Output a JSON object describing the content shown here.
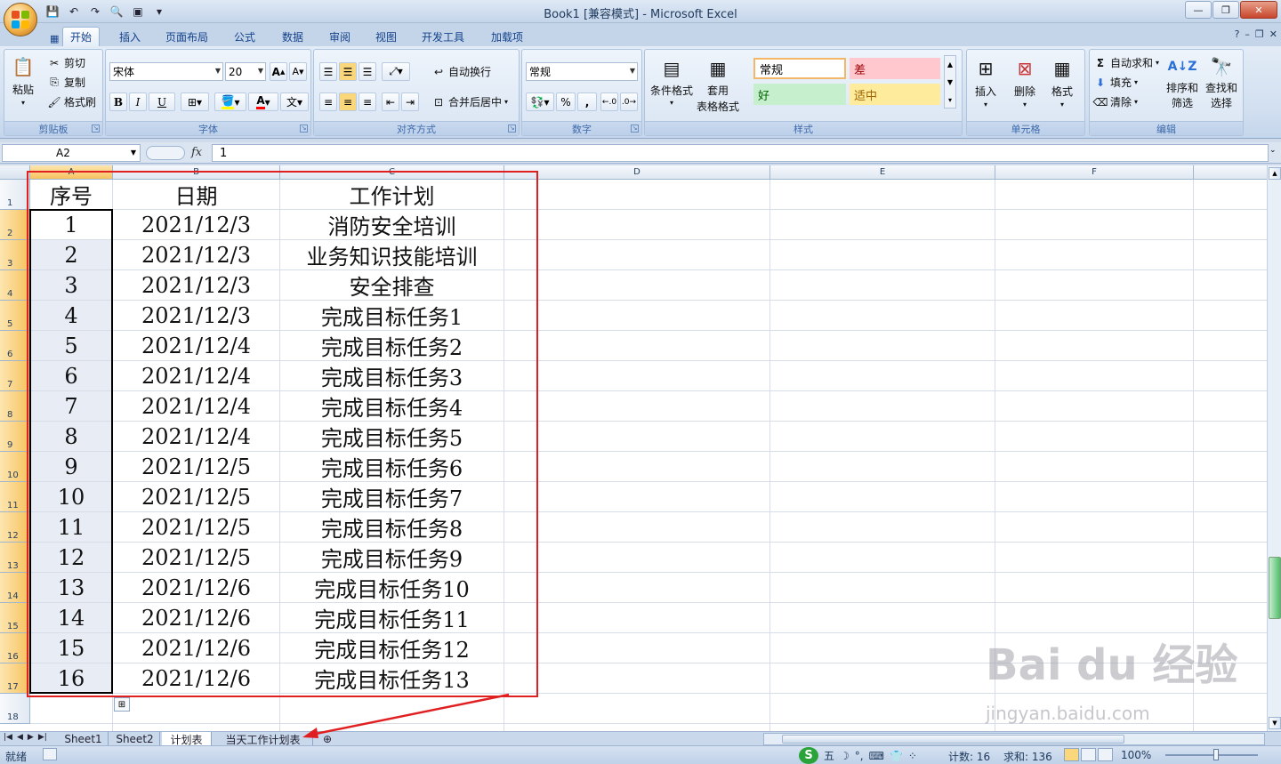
{
  "window": {
    "title": "Book1  [兼容模式] - Microsoft Excel"
  },
  "ribbon_tabs": [
    "开始",
    "插入",
    "页面布局",
    "公式",
    "数据",
    "审阅",
    "视图",
    "开发工具",
    "加载项"
  ],
  "clipboard": {
    "paste": "粘贴",
    "cut": "剪切",
    "copy": "复制",
    "format_painter": "格式刷",
    "label": "剪贴板"
  },
  "font": {
    "name": "宋体",
    "size": "20",
    "bold": "B",
    "italic": "I",
    "underline": "U",
    "label": "字体"
  },
  "alignment": {
    "wrap_text": "自动换行",
    "merge_center": "合并后居中",
    "label": "对齐方式"
  },
  "number": {
    "format": "常规",
    "percent": "%",
    "comma": ",",
    "label": "数字"
  },
  "styles": {
    "conditional": "条件格式",
    "table_line1": "套用",
    "table_line2": "表格格式",
    "normal": "常规",
    "bad": "差",
    "good": "好",
    "neutral": "适中",
    "label": "样式",
    "colors": {
      "bad_bg": "#ffc7ce",
      "bad_fg": "#9c0006",
      "good_bg": "#c6efce",
      "good_fg": "#006100",
      "neutral_bg": "#ffeb9c",
      "neutral_fg": "#9c6500"
    }
  },
  "cells_group": {
    "insert": "插入",
    "delete": "删除",
    "format": "格式",
    "label": "单元格"
  },
  "editing": {
    "autosum": "自动求和",
    "fill": "填充",
    "clear": "清除",
    "sort_line1": "排序和",
    "sort_line2": "筛选",
    "find_line1": "查找和",
    "find_line2": "选择",
    "label": "编辑"
  },
  "formula_bar": {
    "name_box": "A2",
    "fx": "fx",
    "value": "1"
  },
  "columns": [
    "A",
    "B",
    "C",
    "D",
    "E",
    "F"
  ],
  "row_numbers": [
    "1",
    "2",
    "3",
    "4",
    "5",
    "6",
    "7",
    "8",
    "9",
    "10",
    "11",
    "12",
    "13",
    "14",
    "15",
    "16",
    "17",
    "18"
  ],
  "table": {
    "headers": [
      "序号",
      "日期",
      "工作计划"
    ],
    "rows": [
      [
        "1",
        "2021/12/3",
        "消防安全培训"
      ],
      [
        "2",
        "2021/12/3",
        "业务知识技能培训"
      ],
      [
        "3",
        "2021/12/3",
        "安全排查"
      ],
      [
        "4",
        "2021/12/3",
        "完成目标任务1"
      ],
      [
        "5",
        "2021/12/4",
        "完成目标任务2"
      ],
      [
        "6",
        "2021/12/4",
        "完成目标任务3"
      ],
      [
        "7",
        "2021/12/4",
        "完成目标任务4"
      ],
      [
        "8",
        "2021/12/4",
        "完成目标任务5"
      ],
      [
        "9",
        "2021/12/5",
        "完成目标任务6"
      ],
      [
        "10",
        "2021/12/5",
        "完成目标任务7"
      ],
      [
        "11",
        "2021/12/5",
        "完成目标任务8"
      ],
      [
        "12",
        "2021/12/5",
        "完成目标任务9"
      ],
      [
        "13",
        "2021/12/6",
        "完成目标任务10"
      ],
      [
        "14",
        "2021/12/6",
        "完成目标任务11"
      ],
      [
        "15",
        "2021/12/6",
        "完成目标任务12"
      ],
      [
        "16",
        "2021/12/6",
        "完成目标任务13"
      ]
    ]
  },
  "sheet_tabs": [
    "Sheet1",
    "Sheet2",
    "计划表",
    "当天工作计划表"
  ],
  "active_sheet": "计划表",
  "status": {
    "ready": "就绪",
    "ime": "五",
    "count": "计数: 16",
    "sum": "求和: 136",
    "zoom": "100%"
  },
  "watermark": {
    "brand": "Bai du 经验",
    "url": "jingyan.baidu.com"
  }
}
